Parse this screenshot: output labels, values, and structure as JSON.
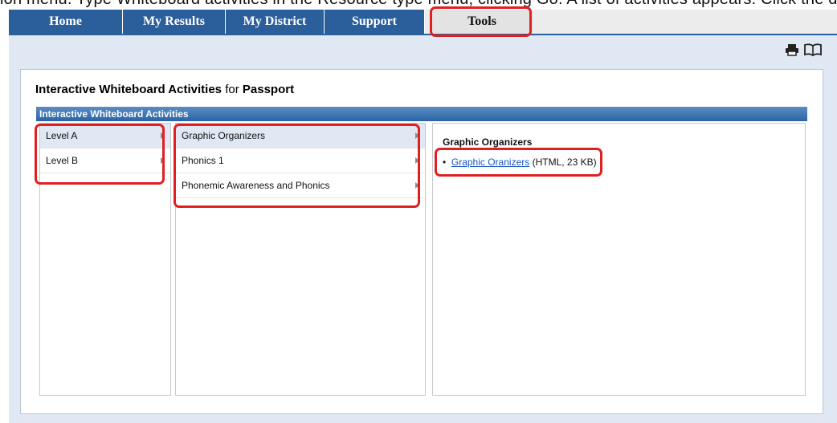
{
  "top_strip_text": "ion menu. Type Whiteboard activities in the Resource type menu, clicking Go. A list of activities appears. Click the desired activity",
  "nav": {
    "tabs": [
      {
        "label": "Home"
      },
      {
        "label": "My Results"
      },
      {
        "label": "My District"
      },
      {
        "label": "Support"
      },
      {
        "label": "Tools"
      }
    ],
    "selected": "Tools"
  },
  "toolbar": {
    "print_icon": "printer-icon",
    "book_icon": "open-book-icon"
  },
  "page": {
    "title_main": "Interactive Whiteboard Activities",
    "title_for": "for",
    "title_program": "Passport"
  },
  "section": {
    "header": "Interactive Whiteboard Activities"
  },
  "columns": {
    "levels": [
      {
        "label": "Level A"
      },
      {
        "label": "Level B"
      }
    ],
    "categories": [
      {
        "label": "Graphic Organizers"
      },
      {
        "label": "Phonics 1"
      },
      {
        "label": "Phonemic Awareness and Phonics"
      }
    ],
    "detail": {
      "title": "Graphic Organizers",
      "items": [
        {
          "bullet": "•",
          "link_text": "Graphic Oranizers",
          "meta": "(HTML, 23 KB)"
        }
      ]
    }
  },
  "colors": {
    "nav_blue": "#2a5f9b",
    "panel_blue": "#dfe8f3",
    "highlight_red": "#e02020",
    "link_blue": "#1a56c8"
  }
}
